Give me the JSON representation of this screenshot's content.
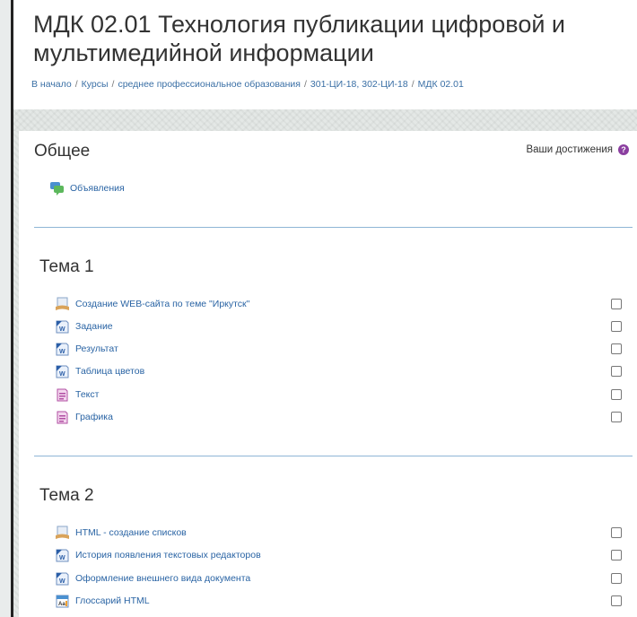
{
  "page": {
    "title": "МДК 02.01 Технология публикации цифровой и мультимедийной информации"
  },
  "breadcrumb": [
    "В начало",
    "Курсы",
    "среднее профессиональное образования",
    "301-ЦИ-18, 302-ЦИ-18",
    "МДК 02.01"
  ],
  "general": {
    "title": "Общее",
    "achievements_label": "Ваши достижения",
    "items": [
      {
        "label": "Объявления",
        "icon": "forum-icon"
      }
    ]
  },
  "topic1": {
    "title": "Тема 1",
    "items": [
      {
        "label": "Создание WEB-сайта по теме \"Иркутск\"",
        "icon": "lesson-icon"
      },
      {
        "label": "Задание",
        "icon": "word-document-icon"
      },
      {
        "label": "Результат",
        "icon": "word-document-icon"
      },
      {
        "label": "Таблица цветов",
        "icon": "word-document-icon"
      },
      {
        "label": "Текст",
        "icon": "text-file-icon"
      },
      {
        "label": "Графика",
        "icon": "text-file-icon"
      }
    ]
  },
  "topic2": {
    "title": "Тема 2",
    "items": [
      {
        "label": "HTML - создание списков",
        "icon": "lesson-icon"
      },
      {
        "label": "История появления текстовых редакторов",
        "icon": "word-document-icon"
      },
      {
        "label": "Оформление внешнего вида документа",
        "icon": "word-document-icon"
      },
      {
        "label": "Глоссарий HTML",
        "icon": "glossary-icon"
      }
    ]
  },
  "colors": {
    "link": "#2a64a4",
    "divider": "#8fb6d6",
    "help": "#8b3fa0"
  }
}
